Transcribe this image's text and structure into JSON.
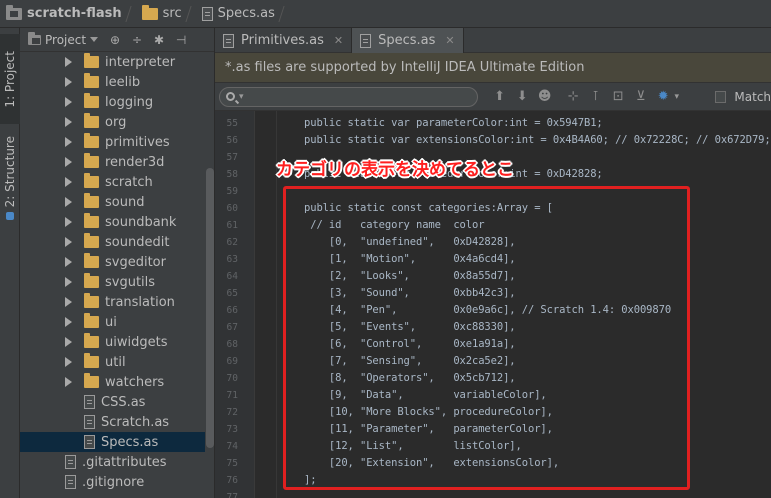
{
  "breadcrumb": {
    "project": "scratch-flash",
    "folder": "src",
    "file": "Specs.as"
  },
  "tool_strip": {
    "project_tab": "1: Project",
    "structure_tab": "2: Structure"
  },
  "project_panel": {
    "view_label": "Project",
    "items": [
      {
        "label": "interpreter",
        "type": "folder"
      },
      {
        "label": "leelib",
        "type": "folder"
      },
      {
        "label": "logging",
        "type": "folder"
      },
      {
        "label": "org",
        "type": "folder"
      },
      {
        "label": "primitives",
        "type": "folder"
      },
      {
        "label": "render3d",
        "type": "folder"
      },
      {
        "label": "scratch",
        "type": "folder"
      },
      {
        "label": "sound",
        "type": "folder"
      },
      {
        "label": "soundbank",
        "type": "folder"
      },
      {
        "label": "soundedit",
        "type": "folder"
      },
      {
        "label": "svgeditor",
        "type": "folder"
      },
      {
        "label": "svgutils",
        "type": "folder"
      },
      {
        "label": "translation",
        "type": "folder"
      },
      {
        "label": "ui",
        "type": "folder"
      },
      {
        "label": "uiwidgets",
        "type": "folder"
      },
      {
        "label": "util",
        "type": "folder"
      },
      {
        "label": "watchers",
        "type": "folder"
      },
      {
        "label": "CSS.as",
        "type": "file"
      },
      {
        "label": "Scratch.as",
        "type": "file"
      },
      {
        "label": "Specs.as",
        "type": "file",
        "selected": true
      },
      {
        "label": ".gitattributes",
        "type": "rootfile"
      },
      {
        "label": ".gitignore",
        "type": "rootfile"
      }
    ]
  },
  "tabs": [
    {
      "label": "Primitives.as",
      "active": false
    },
    {
      "label": "Specs.as",
      "active": true
    }
  ],
  "warning": "*.as files are supported by IntelliJ IDEA Ultimate Edition",
  "search": {
    "value": "",
    "match_label": "Match"
  },
  "editor": {
    "lines": [
      {
        "n": "55",
        "text": "public static var parameterColor:int = 0x5947B1;",
        "indent": 0
      },
      {
        "n": "56",
        "text": "public static var extensionsColor:int = 0x4B4A60; // 0x72228C; // 0x672D79;",
        "indent": 0
      },
      {
        "n": "57",
        "text": "",
        "indent": 0
      },
      {
        "n": "58",
        "text": "public static var procedureColor:int = 0xD42828;",
        "indent": 0
      },
      {
        "n": "59",
        "text": "",
        "indent": 0
      },
      {
        "n": "60",
        "text": "public static const categories:Array = [",
        "indent": 0
      },
      {
        "n": "61",
        "text": " // id   category name  color",
        "indent": 0
      },
      {
        "n": "62",
        "text": "    [0,  \"undefined\",   0xD42828],",
        "indent": 0
      },
      {
        "n": "63",
        "text": "    [1,  \"Motion\",      0x4a6cd4],",
        "indent": 0
      },
      {
        "n": "64",
        "text": "    [2,  \"Looks\",       0x8a55d7],",
        "indent": 0
      },
      {
        "n": "65",
        "text": "    [3,  \"Sound\",       0xbb42c3],",
        "indent": 0
      },
      {
        "n": "66",
        "text": "    [4,  \"Pen\",         0x0e9a6c], // Scratch 1.4: 0x009870",
        "indent": 0
      },
      {
        "n": "67",
        "text": "    [5,  \"Events\",      0xc88330],",
        "indent": 0
      },
      {
        "n": "68",
        "text": "    [6,  \"Control\",     0xe1a91a],",
        "indent": 0
      },
      {
        "n": "69",
        "text": "    [7,  \"Sensing\",     0x2ca5e2],",
        "indent": 0
      },
      {
        "n": "70",
        "text": "    [8,  \"Operators\",   0x5cb712],",
        "indent": 0
      },
      {
        "n": "71",
        "text": "    [9,  \"Data\",        variableColor],",
        "indent": 0
      },
      {
        "n": "72",
        "text": "    [10, \"More Blocks\", procedureColor],",
        "indent": 0
      },
      {
        "n": "73",
        "text": "    [11, \"Parameter\",   parameterColor],",
        "indent": 0
      },
      {
        "n": "74",
        "text": "    [12, \"List\",        listColor],",
        "indent": 0
      },
      {
        "n": "75",
        "text": "    [20, \"Extension\",   extensionsColor],",
        "indent": 0
      },
      {
        "n": "76",
        "text": "];",
        "indent": 0
      },
      {
        "n": "77",
        "text": "",
        "indent": 0
      }
    ]
  },
  "annotation": {
    "caption": "カテゴリの表示を決めてるとこ",
    "color": "#e02020"
  }
}
